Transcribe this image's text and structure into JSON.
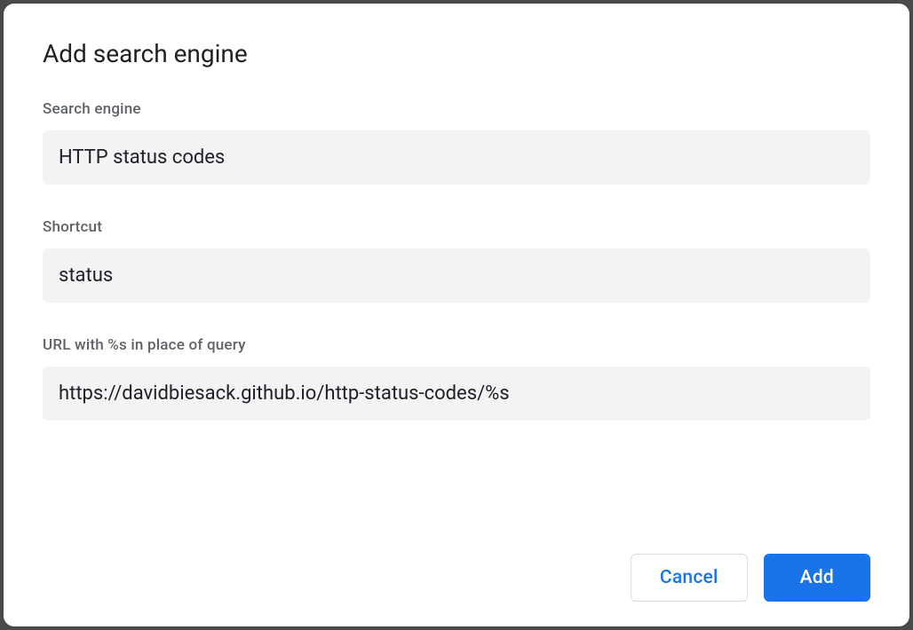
{
  "dialog": {
    "title": "Add search engine",
    "fields": {
      "search_engine": {
        "label": "Search engine",
        "value": "HTTP status codes"
      },
      "shortcut": {
        "label": "Shortcut",
        "value": "status"
      },
      "url": {
        "label": "URL with %s in place of query",
        "value": "https://davidbiesack.github.io/http-status-codes/%s"
      }
    },
    "buttons": {
      "cancel": "Cancel",
      "add": "Add"
    }
  }
}
